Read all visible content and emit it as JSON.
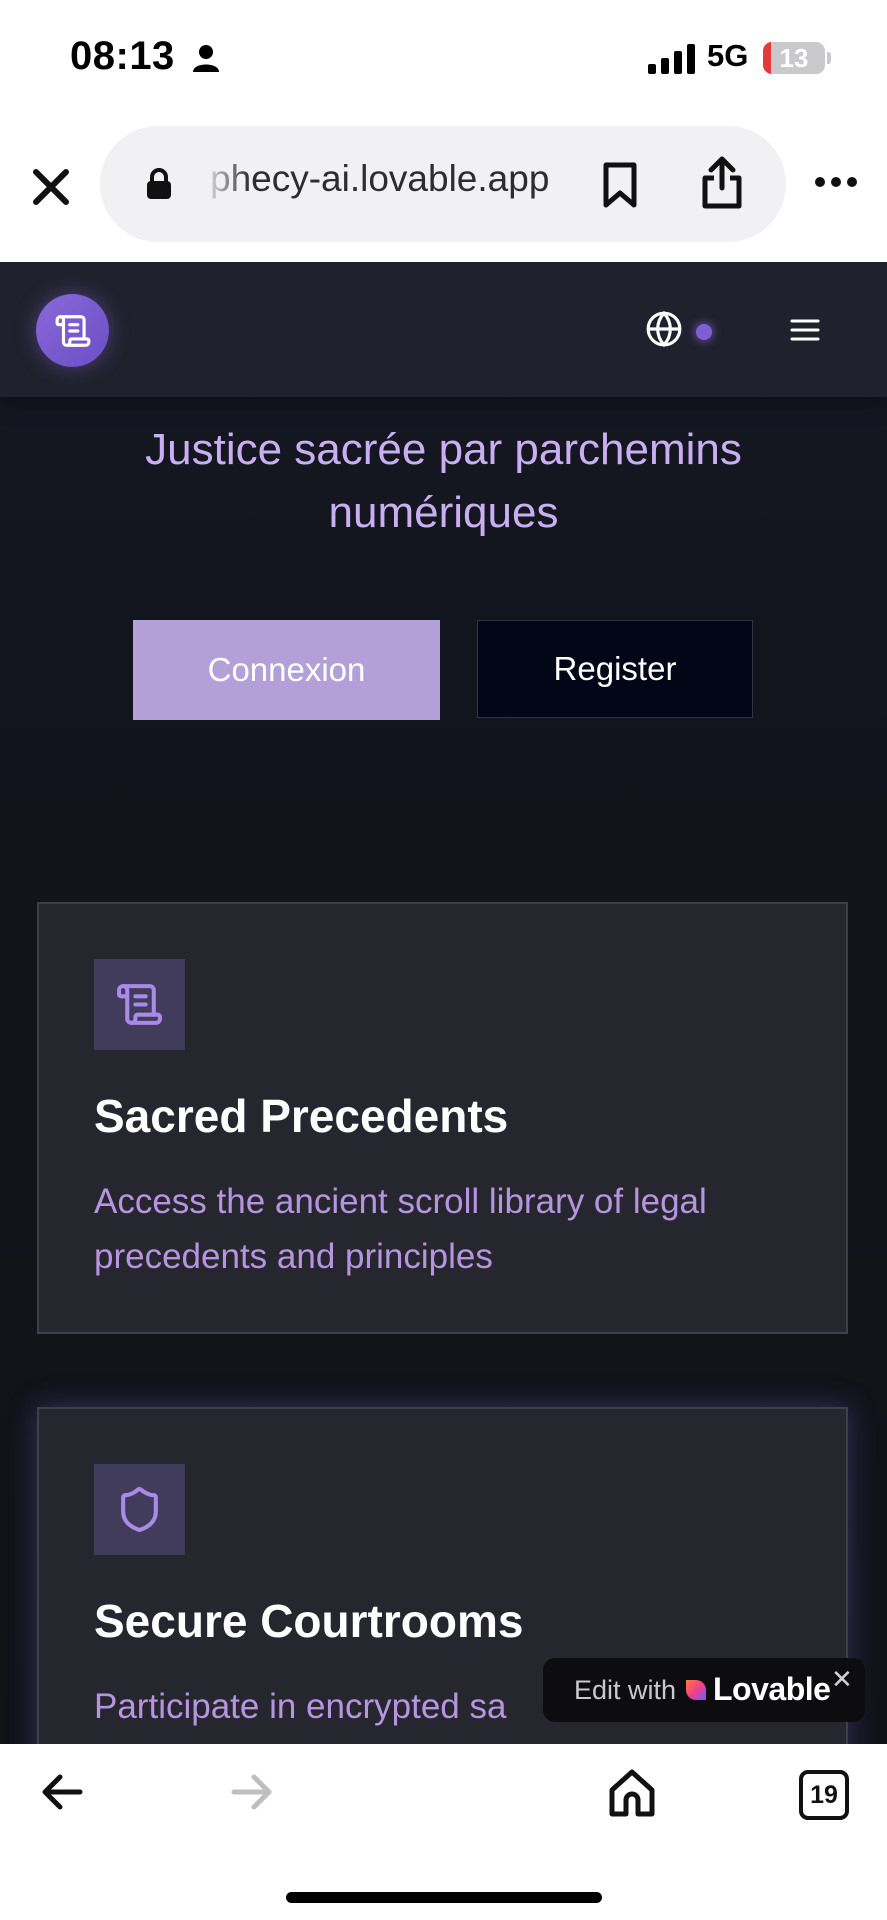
{
  "status_bar": {
    "time": "08:13",
    "network": "5G",
    "battery": "13",
    "battery_level_percent": 13
  },
  "browser": {
    "url": "phecy-ai.lovable.app",
    "icons": [
      "close-icon",
      "lock-icon",
      "bookmark-icon",
      "share-icon",
      "more-icon"
    ]
  },
  "site": {
    "tagline": "Justice sacrée par parchemins numériques",
    "login_label": "Connexion",
    "register_label": "Register",
    "cards": [
      {
        "icon": "scroll-icon",
        "title": "Sacred Precedents",
        "description": "Access the ancient scroll library of legal precedents and principles"
      },
      {
        "icon": "shield-icon",
        "title": "Secure Courtrooms",
        "description": "Participate in encrypted sa"
      }
    ],
    "colors": {
      "accent": "#8a68d9",
      "tagline": "#caaef2",
      "login_bg": "#b3a0d8",
      "card_text": "#b694e0"
    }
  },
  "lovable_badge": {
    "edit_with": "Edit with",
    "brand": "Lovable",
    "close": "✕"
  },
  "toolbar": {
    "tab_count": "19",
    "icons": [
      "back-arrow-icon",
      "forward-arrow-icon",
      "home-icon",
      "tabs-icon"
    ]
  }
}
